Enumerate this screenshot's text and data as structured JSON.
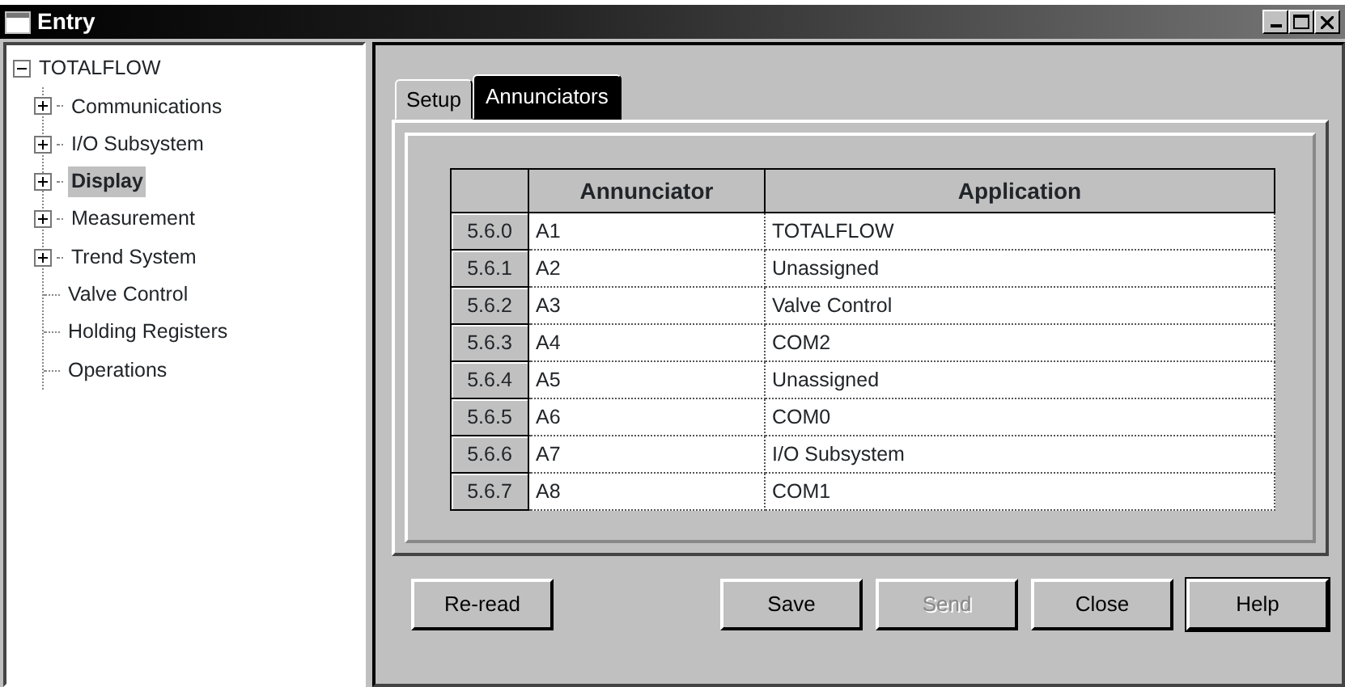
{
  "window": {
    "title": "Entry"
  },
  "tree": {
    "label": "TOTALFLOW",
    "expanded": true,
    "selected": false,
    "children": [
      {
        "label": "Communications",
        "kind": "folder",
        "expanded": false,
        "selected": false
      },
      {
        "label": "I/O Subsystem",
        "kind": "folder",
        "expanded": false,
        "selected": false
      },
      {
        "label": "Display",
        "kind": "folder",
        "expanded": false,
        "selected": true
      },
      {
        "label": "Measurement",
        "kind": "folder",
        "expanded": false,
        "selected": false
      },
      {
        "label": "Trend System",
        "kind": "folder",
        "expanded": false,
        "selected": false
      },
      {
        "label": "Valve Control",
        "kind": "leaf",
        "selected": false
      },
      {
        "label": "Holding Registers",
        "kind": "leaf",
        "selected": false
      },
      {
        "label": "Operations",
        "kind": "leaf",
        "selected": false
      }
    ]
  },
  "tabs": [
    {
      "label": "Setup",
      "selected": false
    },
    {
      "label": "Annunciators",
      "selected": true
    }
  ],
  "table": {
    "columns": [
      "Annunciator",
      "Application"
    ],
    "rows": [
      {
        "index": "5.6.0",
        "annunciator": "A1",
        "application": "TOTALFLOW"
      },
      {
        "index": "5.6.1",
        "annunciator": "A2",
        "application": "Unassigned"
      },
      {
        "index": "5.6.2",
        "annunciator": "A3",
        "application": "Valve Control"
      },
      {
        "index": "5.6.3",
        "annunciator": "A4",
        "application": "COM2"
      },
      {
        "index": "5.6.4",
        "annunciator": "A5",
        "application": "Unassigned"
      },
      {
        "index": "5.6.5",
        "annunciator": "A6",
        "application": "COM0"
      },
      {
        "index": "5.6.6",
        "annunciator": "A7",
        "application": "I/O Subsystem"
      },
      {
        "index": "5.6.7",
        "annunciator": "A8",
        "application": "COM1"
      }
    ]
  },
  "buttons_left": [
    {
      "label": "Re-read",
      "disabled": false,
      "default": false
    }
  ],
  "buttons_right": [
    {
      "label": "Save",
      "disabled": false,
      "default": false
    },
    {
      "label": "Send",
      "disabled": true,
      "default": false
    },
    {
      "label": "Close",
      "disabled": false,
      "default": false
    },
    {
      "label": "Help",
      "disabled": false,
      "default": true
    }
  ]
}
